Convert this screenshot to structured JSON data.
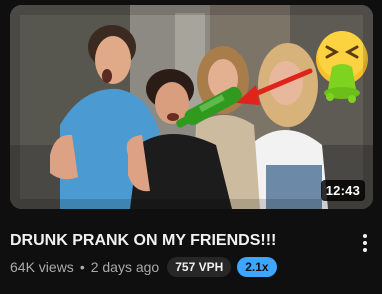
{
  "video": {
    "title": "DRUNK PRANK ON MY FRIENDS!!!",
    "duration": "12:43",
    "views": "64K views",
    "separator": "•",
    "age": "2 days ago",
    "vph_badge": "757 VPH",
    "multiplier_badge": "2.1x",
    "more_icon": "vertical-ellipsis-icon"
  },
  "colors": {
    "background": "#0f0f0f",
    "title_text": "#f1f1f1",
    "meta_text": "#aaaaaa",
    "vph_badge_bg": "#272727",
    "multiplier_badge_bg": "#3ea6ff",
    "arrow": "#e0241b",
    "bottle": "#2f9a1e"
  }
}
